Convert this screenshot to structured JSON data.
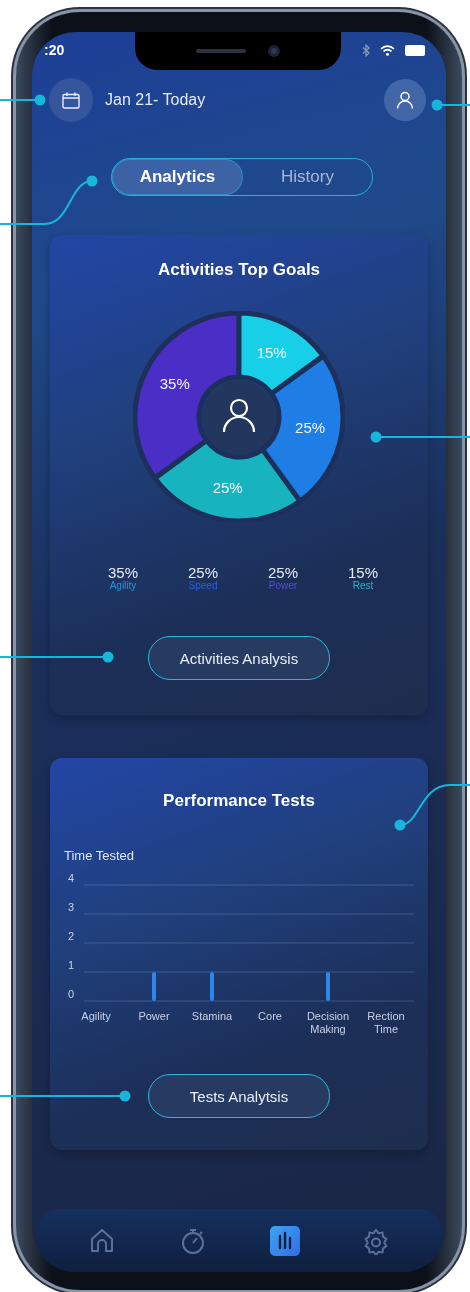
{
  "status_bar": {
    "time": ":20"
  },
  "header": {
    "date_range": "Jan 21- Today"
  },
  "tabs": [
    {
      "label": "Analytics",
      "selected": true
    },
    {
      "label": "History",
      "selected": false
    }
  ],
  "goals_card": {
    "chart_data": {
      "type": "donut",
      "title": "Activities Top Goals",
      "categories": [
        "Agility",
        "Speed",
        "Power",
        "Rest"
      ],
      "series": [
        {
          "values": [
            35,
            25,
            25,
            15
          ]
        }
      ],
      "value_labels": [
        "35%",
        "25%",
        "25%",
        "15%"
      ]
    },
    "legend": [
      {
        "value": "35%",
        "color": "#2a8fd6"
      },
      {
        "value": "25%",
        "color": "#2a5ee0"
      },
      {
        "value": "25%",
        "color": "#5a46e0"
      },
      {
        "value": "15%",
        "color": "#22b4c8"
      }
    ],
    "button": "Activities Analysis"
  },
  "tests_card": {
    "title": "Performance Tests",
    "chart_data": {
      "type": "bar",
      "ylabel": "Time Tested",
      "categories": [
        "Agility",
        "Power",
        "Stamina",
        "Core",
        "Decision Making",
        "Rection Time"
      ],
      "series": [
        {
          "color": "#2f86ea",
          "values": [
            0,
            1,
            1,
            0,
            1,
            0
          ]
        }
      ],
      "ylim": [
        0,
        4
      ],
      "yticks": [
        0,
        1,
        2,
        3,
        4
      ],
      "grid": true
    },
    "button": "Tests Analytsis"
  },
  "bottom_nav": [
    {
      "selected": false
    },
    {
      "selected": false
    },
    {
      "selected": true
    },
    {
      "selected": false
    }
  ]
}
